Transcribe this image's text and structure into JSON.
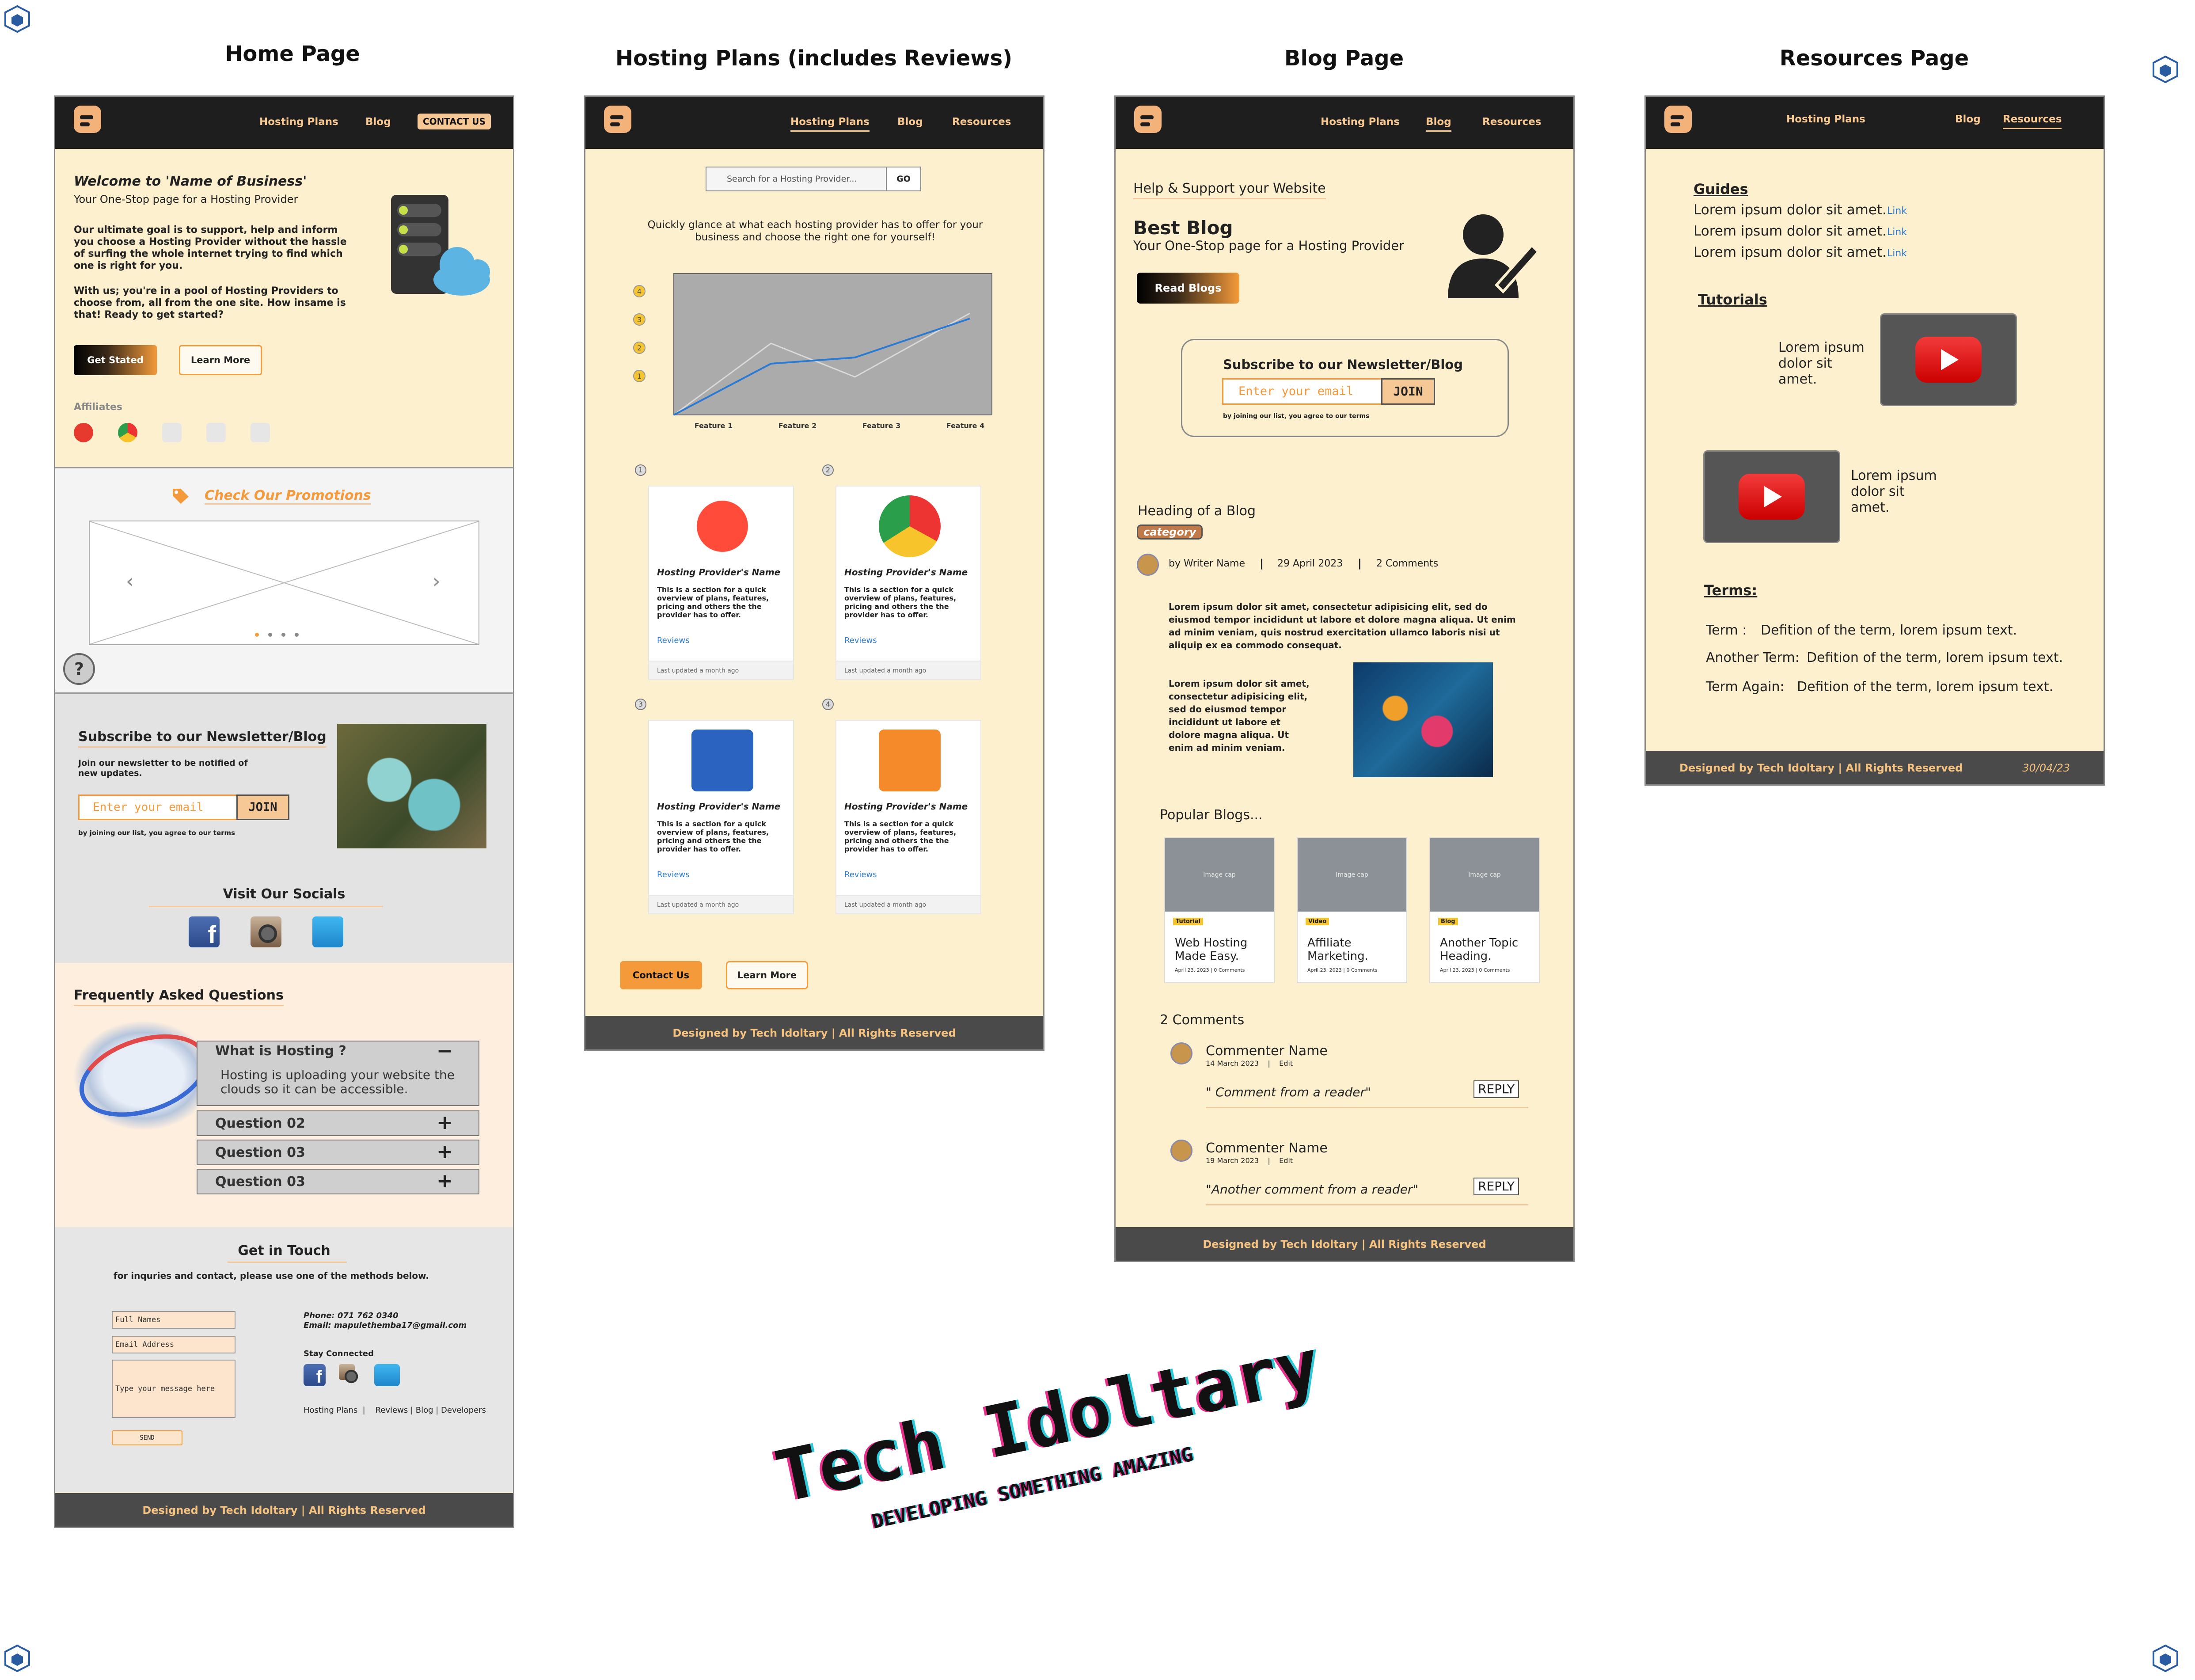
{
  "page_titles": {
    "home": "Home Page",
    "hosting": "Hosting Plans (includes Reviews)",
    "blog": "Blog Page",
    "resources": "Resources Page"
  },
  "nav": {
    "hosting_plans": "Hosting Plans",
    "blog": "Blog",
    "resources": "Resources",
    "contact": "CONTACT US"
  },
  "home": {
    "welcome": "Welcome to 'Name of Business'",
    "tagline": "Your One-Stop page for a Hosting Provider",
    "para1": "Our ultimate goal is to support, help and inform you choose a Hosting Provider without the hassle of surfing the whole internet trying to find which one is right for you.",
    "para2": "With us; you're in a pool of Hosting Providers to choose from, all from the one site. How insame is that! Ready to get started?",
    "get_started": "Get Stated",
    "learn_more": "Learn More",
    "affiliates": "Affiliates",
    "promotions": "Check Our Promotions",
    "help": "?",
    "newsletter_title": "Subscribe to our Newsletter/Blog",
    "newsletter_desc": "Join our newsletter to be notified of new updates.",
    "email_placeholder": "Enter your email",
    "join": "JOIN",
    "terms_note": "by joining our list, you agree to our terms",
    "socials": "Visit Our Socials",
    "faq_title": "Frequently Asked Questions",
    "faq": [
      {
        "q": "What is Hosting ?",
        "a": "Hosting is uploading your website the clouds so it can be accessible.",
        "toggle": "−"
      },
      {
        "q": "Question 02",
        "toggle": "+"
      },
      {
        "q": "Question 03",
        "toggle": "+"
      },
      {
        "q": "Question 03",
        "toggle": "+"
      }
    ],
    "contact_title": "Get in Touch",
    "contact_desc": "for inquries and contact, please use one of the methods below.",
    "full_names": "Full Names",
    "email_address": "Email Address",
    "message": "Type your message here",
    "send": "SEND",
    "phone": "Phone: 071 762 0340",
    "email": "Email: mapulethemba17@gmail.com",
    "stay_connected": "Stay Connected",
    "footer_links": "Hosting Plans  |    Reviews | Blog | Developers",
    "footer": "Designed by Tech Idoltary | All Rights Reserved"
  },
  "hosting": {
    "search_placeholder": "Search for a Hosting Provider...",
    "go": "GO",
    "intro": "Quickly glance at what each hosting provider has to offer for your business and choose the right one for yourself!",
    "chart_y": [
      "4",
      "3",
      "2",
      "1"
    ],
    "chart_x": [
      "Feature 1",
      "Feature 2",
      "Feature 3",
      "Feature 4"
    ],
    "cards": [
      {
        "num": "1",
        "name": "Hosting Provider's Name",
        "desc": "This is a section for a quick overview of plans, features, pricing and others the the provider has to offer.",
        "reviews": "Reviews",
        "updated": "Last updated a month ago"
      },
      {
        "num": "2",
        "name": "Hosting Provider's Name",
        "desc": "This is a section for a quick overview of plans, features, pricing and others the the provider has to offer.",
        "reviews": "Reviews",
        "updated": "Last updated a month ago"
      },
      {
        "num": "3",
        "name": "Hosting Provider's Name",
        "desc": "This is a section for a quick overview of plans, features, pricing and others the the provider has to offer.",
        "reviews": "Reviews",
        "updated": "Last updated a month ago"
      },
      {
        "num": "4",
        "name": "Hosting Provider's Name",
        "desc": "This is a section for a quick overview of plans, features, pricing and others the the provider has to offer.",
        "reviews": "Reviews",
        "updated": "Last updated a month ago"
      }
    ],
    "contact_us": "Contact Us",
    "learn_more": "Learn More",
    "footer": "Designed by Tech Idoltary | All Rights Reserved"
  },
  "blog": {
    "help": "Help & Support your Website",
    "best_blog": "Best Blog",
    "tagline": "Your One-Stop page for a Hosting Provider",
    "read_blogs": "Read Blogs",
    "newsletter_title": "Subscribe to our Newsletter/Blog",
    "email_placeholder": "Enter your email",
    "join": "JOIN",
    "terms_note": "by joining our list, you agree to our terms",
    "heading": "Heading of a Blog",
    "category": "category",
    "writer": "by Writer Name",
    "sep1": "|",
    "date": "29 April 2023",
    "sep2": "|",
    "comments_count": "2 Comments",
    "para1": "Lorem ipsum dolor sit amet, consectetur adipisicing elit, sed do eiusmod tempor incididunt ut labore et dolore magna aliqua. Ut enim ad minim veniam, quis nostrud exercitation ullamco laboris nisi ut aliquip ex ea commodo consequat.",
    "para2": "Lorem ipsum dolor sit amet, consectetur adipisicing elit, sed do eiusmod tempor incididunt ut labore et dolore magna aliqua. Ut enim ad minim veniam.",
    "popular": "Popular Blogs...",
    "popular_cards": [
      {
        "img": "Image cap",
        "tag": "Tutorial",
        "title": "Web Hosting Made Easy.",
        "meta": "April 23, 2023   | 0 Comments"
      },
      {
        "img": "Image cap",
        "tag": "Video",
        "title": "Affiliate Marketing.",
        "meta": "April 23, 2023   | 0 Comments"
      },
      {
        "img": "Image cap",
        "tag": "Blog",
        "title": "Another Topic Heading.",
        "meta": "April 23, 2023   | 0 Comments"
      }
    ],
    "comments_title": "2 Comments",
    "comments": [
      {
        "name": "Commenter Name",
        "meta": "14 March 2023    |    Edit",
        "text": "\" Comment from a reader\"",
        "reply": "REPLY"
      },
      {
        "name": "Commenter Name",
        "meta": "19 March 2023    |    Edit",
        "text": "\"Another comment from a reader\"",
        "reply": "REPLY"
      }
    ],
    "footer": "Designed by Tech Idoltary | All Rights Reserved"
  },
  "resources": {
    "guides": "Guides",
    "guide_items": [
      {
        "text": "Lorem ipsum dolor sit amet.",
        "link": "Link"
      },
      {
        "text": "Lorem ipsum dolor sit amet.",
        "link": "Link"
      },
      {
        "text": "Lorem ipsum dolor sit amet.",
        "link": "Link"
      }
    ],
    "tutorials": "Tutorials",
    "tutorial_text1": "Lorem ipsum dolor sit amet.",
    "tutorial_text2": "Lorem ipsum dolor sit amet.",
    "terms": "Terms:",
    "term_items": [
      {
        "term": "Term :",
        "def": "Defition of the term, lorem ipsum text."
      },
      {
        "term": "Another Term:",
        "def": "Defition of the term, lorem ipsum text."
      },
      {
        "term": "Term Again:",
        "def": "Defition of the term, lorem ipsum text."
      }
    ],
    "footer": "Designed by Tech Idoltary | All Rights Reserved",
    "footer_date": "30/04/23"
  },
  "brand": {
    "name": "Tech Idoltary",
    "slogan": "DEVELOPING SOMETHING AMAZING"
  },
  "colors": {
    "nav_bg": "#1e1e1e",
    "accent": "#f49a3a",
    "page_bg": "#fdf0cf",
    "footer_bg": "#4a4a4a"
  }
}
